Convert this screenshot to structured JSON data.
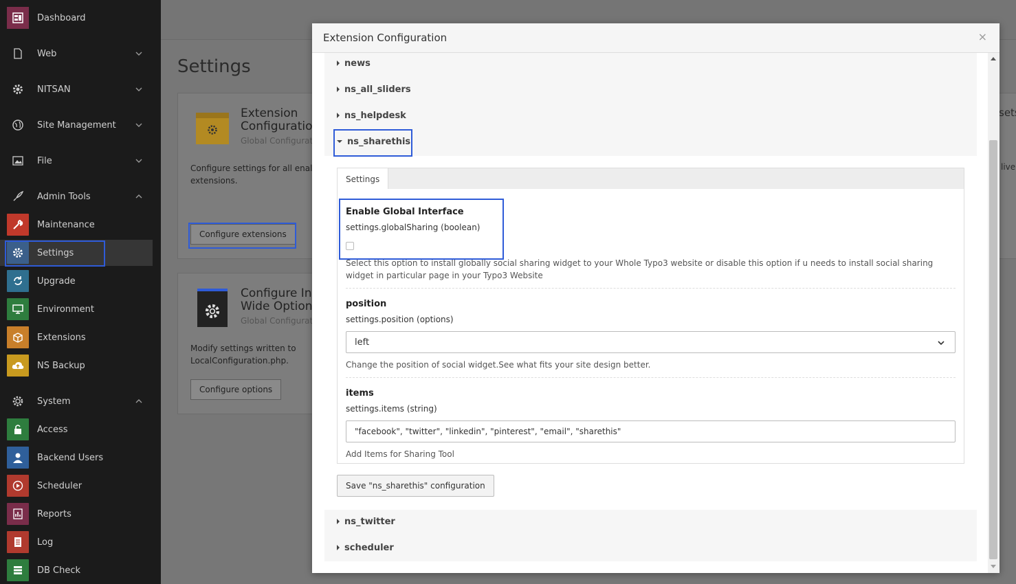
{
  "sidebar": {
    "groups": [
      {
        "label": "Dashboard",
        "icon": "dashboard-icon"
      },
      {
        "label": "Web",
        "icon": "web-page-icon"
      },
      {
        "label": "NITSAN",
        "icon": "gear-icon"
      },
      {
        "label": "Site Management",
        "icon": "globe-icon"
      },
      {
        "label": "File",
        "icon": "image-icon"
      },
      {
        "label": "Admin Tools",
        "icon": "rocket-icon"
      },
      {
        "label": "System",
        "icon": "gear-outline-icon"
      }
    ],
    "admin_modules": [
      {
        "label": "Maintenance",
        "icon": "wrench-icon",
        "color": "#c0392b"
      },
      {
        "label": "Settings",
        "icon": "gear-icon",
        "color": "#3b5f8a"
      },
      {
        "label": "Upgrade",
        "icon": "refresh-icon",
        "color": "#2f6f8f"
      },
      {
        "label": "Environment",
        "icon": "monitor-icon",
        "color": "#2e7d3e"
      },
      {
        "label": "Extensions",
        "icon": "box-icon",
        "color": "#c87f2a"
      },
      {
        "label": "NS Backup",
        "icon": "cloud-upload-icon",
        "color": "#c89a1f"
      }
    ],
    "system_modules": [
      {
        "label": "Access",
        "icon": "lock-icon",
        "color": "#2e7d3e"
      },
      {
        "label": "Backend Users",
        "icon": "user-icon",
        "color": "#2f5f9a"
      },
      {
        "label": "Scheduler",
        "icon": "play-icon",
        "color": "#b03a2e"
      },
      {
        "label": "Reports",
        "icon": "report-icon",
        "color": "#7a2d4a"
      },
      {
        "label": "Log",
        "icon": "log-icon",
        "color": "#b03a2e"
      },
      {
        "label": "DB Check",
        "icon": "database-icon",
        "color": "#2e7d3e"
      }
    ]
  },
  "page": {
    "title": "Settings",
    "card1": {
      "title_line1": "Extension",
      "title_line2": "Configuration",
      "subtitle": "Global Configurat",
      "desc_line1": "Configure settings for all enal",
      "desc_line2": "extensions.",
      "button": "Configure extensions"
    },
    "card2": {
      "title_line1": "Configure Ins",
      "title_line2": "Wide Options",
      "subtitle": "Global Configurat",
      "desc_line1": "Modify settings written to",
      "desc_line2": "LocalConfiguration.php.",
      "button": "Configure options"
    },
    "right_fragments": [
      "sets",
      "live"
    ]
  },
  "modal": {
    "title": "Extension Configuration",
    "close": "×",
    "extensions_above": [
      "news",
      "ns_all_sliders",
      "ns_helpdesk"
    ],
    "open_extension": "ns_sharethis",
    "extensions_below": [
      "ns_twitter",
      "scheduler"
    ],
    "tab_label": "Settings",
    "fields": {
      "global": {
        "title": "Enable Global Interface",
        "key": "settings.globalSharing (boolean)",
        "checked": false,
        "desc_line1": "Select this option to install globally social sharing widget to your Whole Typo3 website or disable this option if u needs to install social sharing",
        "desc_line2": "widget in particular page in your Typo3 Website"
      },
      "position": {
        "title": "position",
        "key": "settings.position (options)",
        "value": "left",
        "desc": "Change the position of social widget.See what fits your site design better."
      },
      "items": {
        "title": "items",
        "key": "settings.items (string)",
        "value": "\"facebook\", \"twitter\", \"linkedin\", \"pinterest\", \"email\", \"sharethis\"",
        "desc": "Add Items for Sharing Tool"
      }
    },
    "save_button": "Save \"ns_sharethis\" configuration"
  },
  "colors": {
    "highlight": "#2e5bd8",
    "sidebar_bg": "#1b1b1b",
    "overlay": "#777777"
  }
}
